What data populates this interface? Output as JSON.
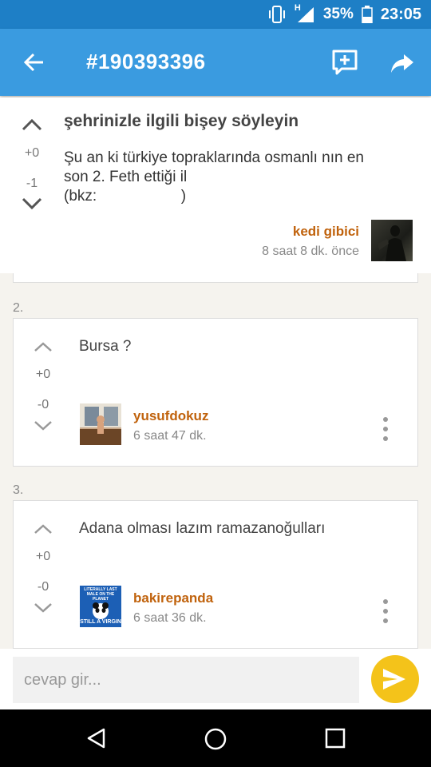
{
  "status_bar": {
    "signal_label": "H",
    "battery": "35%",
    "time": "23:05",
    "icons": [
      "vibrate-icon",
      "signal-icon",
      "battery-icon"
    ]
  },
  "app_bar": {
    "title": "#190393396",
    "icons": [
      "back-arrow-icon",
      "add-comment-icon",
      "share-icon"
    ],
    "color": "#3a9be0"
  },
  "thread": {
    "title": "şehrinizle ilgili bişey söyleyin",
    "body_line1": "Şu an ki türkiye topraklarında osmanlı nın en",
    "body_line2": "son 2. Feth ettiği il",
    "body_line3": "(bkz:                    )",
    "upvotes": "+0",
    "downvotes": "-1",
    "author": "kedi gibici",
    "time": "8 saat 8 dk. önce"
  },
  "replies": [
    {
      "index": "2.",
      "text": "Bursa ?",
      "upvotes": "+0",
      "downvotes": "-0",
      "author": "yusufdokuz",
      "time": "6 saat 47 dk."
    },
    {
      "index": "3.",
      "text": "Adana olması lazım ramazanoğulları",
      "upvotes": "+0",
      "downvotes": "-0",
      "author": "bakirepanda",
      "time": "6 saat 36 dk.",
      "avatar_caption_top": "LITERALLY LAST MALE ON THE PLANET",
      "avatar_caption_bottom": "STILL A VIRGIN"
    }
  ],
  "composer": {
    "placeholder": "cevap gir...",
    "value": ""
  },
  "colors": {
    "accent": "#3a9be0",
    "author": "#c0620c",
    "send": "#f4c31a"
  }
}
